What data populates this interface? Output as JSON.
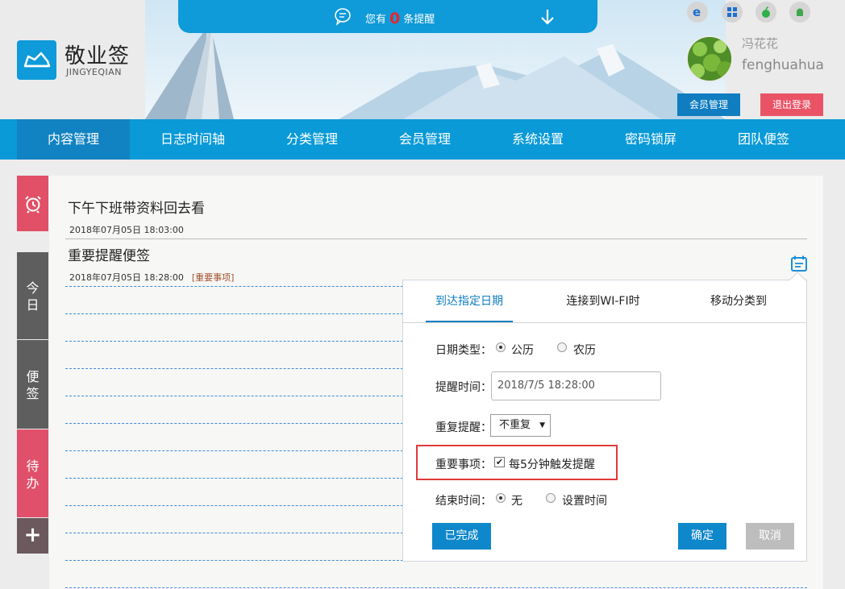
{
  "header": {
    "notice_prefix": "您有",
    "notice_count": "0",
    "notice_suffix": "条提醒",
    "app_name": "敬业签",
    "app_sub": "JINGYEQIAN",
    "user_cn": "冯花花",
    "user_en": "fenghuahua",
    "member_btn": "会员管理",
    "logout_btn": "退出登录",
    "platforms": [
      "ie-icon",
      "windows-icon",
      "apple-icon",
      "android-icon"
    ]
  },
  "nav": {
    "items": [
      {
        "label": "内容管理"
      },
      {
        "label": "日志时间轴"
      },
      {
        "label": "分类管理"
      },
      {
        "label": "会员管理"
      },
      {
        "label": "系统设置"
      },
      {
        "label": "密码锁屏"
      },
      {
        "label": "团队便签"
      }
    ]
  },
  "sidebar": {
    "today": [
      "今",
      "日"
    ],
    "note": [
      "便",
      "签"
    ],
    "todo": [
      "待",
      "办"
    ],
    "plus": "+"
  },
  "notes": [
    {
      "title": "下午下班带资料回去看",
      "time": "2018年07月05日 18:03:00",
      "tag": ""
    },
    {
      "title": "重要提醒便签",
      "time": "2018年07月05日 18:28:00",
      "tag": "[重要事项]"
    }
  ],
  "popup": {
    "tabs": [
      "到达指定日期",
      "连接到WI-FI时",
      "移动分类到"
    ],
    "date_type_label": "日期类型：",
    "date_type_options": [
      "公历",
      "农历"
    ],
    "remind_time_label": "提醒时间：",
    "remind_time_value": "2018/7/5 18:28:00",
    "repeat_label": "重复提醒：",
    "repeat_value": "不重复",
    "important_label": "重要事项：",
    "important_option": "每5分钟触发提醒",
    "end_label": "结束时间：",
    "end_options": [
      "无",
      "设置时间"
    ],
    "done_btn": "已完成",
    "ok_btn": "确定",
    "cancel_btn": "取消"
  },
  "colors": {
    "primary": "#0a9ad8",
    "nav_active": "#1283c2",
    "logout": "#ea5366",
    "alarm": "#e15066",
    "highlight": "#e03a3a"
  }
}
